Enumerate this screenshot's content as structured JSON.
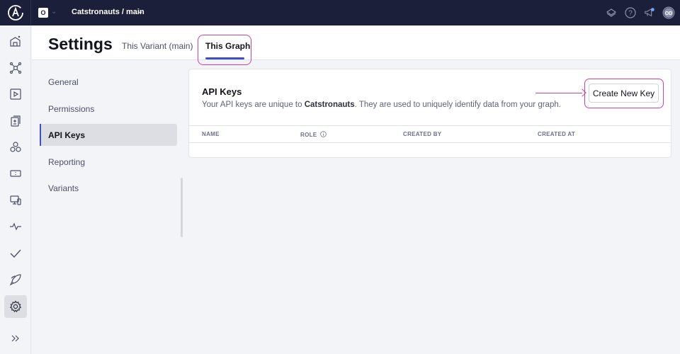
{
  "topbar": {
    "org_initial": "O",
    "graph_name": "Catstronauts / main",
    "icons": [
      "apollo-logo-icon",
      "layers-icon",
      "help-icon",
      "announcement-icon",
      "avatar"
    ],
    "avatar_initials": "OD",
    "notification_dot_color": "#6fa8ff"
  },
  "leftnav": {
    "items": [
      {
        "name": "graph-home-icon"
      },
      {
        "name": "schema-icon"
      },
      {
        "name": "explorer-icon"
      },
      {
        "name": "changelog-icon"
      },
      {
        "name": "subgraphs-icon"
      },
      {
        "name": "fields-icon"
      },
      {
        "name": "clients-icon"
      },
      {
        "name": "insights-icon"
      },
      {
        "name": "checks-icon"
      },
      {
        "name": "launches-icon"
      },
      {
        "name": "settings-icon",
        "active": true
      }
    ],
    "expand_label": "expand"
  },
  "header": {
    "title": "Settings",
    "tabs": [
      {
        "label": "This Variant (main)",
        "active": false
      },
      {
        "label": "This Graph",
        "active": true
      }
    ]
  },
  "subnav": {
    "items": [
      {
        "label": "General",
        "active": false
      },
      {
        "label": "Permissions",
        "active": false
      },
      {
        "label": "API Keys",
        "active": true
      },
      {
        "label": "Reporting",
        "active": false
      },
      {
        "label": "Variants",
        "active": false
      }
    ]
  },
  "card": {
    "title": "API Keys",
    "desc_prefix": "Your API keys are unique to ",
    "desc_bold": "Catstronauts",
    "desc_suffix": ". They are used to uniquely identify data from your graph.",
    "create_button": "Create New Key",
    "columns": [
      "NAME",
      "ROLE",
      "CREATED BY",
      "CREATED AT"
    ],
    "rows": []
  },
  "colors": {
    "topbar_bg": "#1b1f3a",
    "accent": "#3f51c2",
    "highlight": "#d13f9f"
  }
}
